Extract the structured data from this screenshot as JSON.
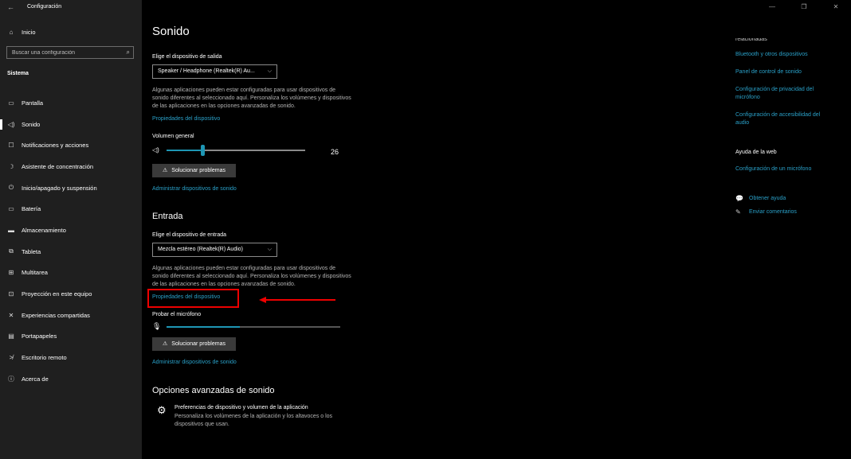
{
  "window": {
    "title": "Configuración",
    "back_icon": "back-arrow-icon"
  },
  "sidebar": {
    "home_label": "Inicio",
    "search": {
      "placeholder": "Buscar una configuración"
    },
    "section": "Sistema",
    "items": [
      {
        "label": "Pantalla",
        "icon": "monitor-icon"
      },
      {
        "label": "Sonido",
        "icon": "speaker-icon",
        "active": true
      },
      {
        "label": "Notificaciones y acciones",
        "icon": "notifications-icon"
      },
      {
        "label": "Asistente de concentración",
        "icon": "moon-icon"
      },
      {
        "label": "Inicio/apagado y suspensión",
        "icon": "power-icon"
      },
      {
        "label": "Batería",
        "icon": "battery-icon"
      },
      {
        "label": "Almacenamiento",
        "icon": "storage-icon"
      },
      {
        "label": "Tableta",
        "icon": "tablet-icon"
      },
      {
        "label": "Multitarea",
        "icon": "multitask-icon"
      },
      {
        "label": "Proyección en este equipo",
        "icon": "projection-icon"
      },
      {
        "label": "Experiencias compartidas",
        "icon": "shared-icon"
      },
      {
        "label": "Portapapeles",
        "icon": "clipboard-icon"
      },
      {
        "label": "Escritorio remoto",
        "icon": "remote-desktop-icon"
      },
      {
        "label": "Acerca de",
        "icon": "info-icon"
      }
    ]
  },
  "main": {
    "title": "Sonido",
    "output": {
      "label": "Elige el dispositivo de salida",
      "device": "Speaker / Headphone (Realtek(R) Au...",
      "description": "Algunas aplicaciones pueden estar configuradas para usar dispositivos de sonido diferentes al seleccionado aquí. Personaliza los volúmenes y dispositivos de las aplicaciones en las opciones avanzadas de sonido.",
      "properties_link": "Propiedades del dispositivo",
      "volume_label": "Volumen general",
      "volume_value": "26",
      "volume_level": 26,
      "troubleshoot": "Solucionar problemas",
      "manage_link": "Administrar dispositivos de sonido"
    },
    "input": {
      "heading": "Entrada",
      "label": "Elige el dispositivo de entrada",
      "device": "Mezcla estéreo (Realtek(R) Audio)",
      "description": "Algunas aplicaciones pueden estar configuradas para usar dispositivos de sonido diferentes al seleccionado aquí. Personaliza los volúmenes y dispositivos de las aplicaciones en las opciones avanzadas de sonido.",
      "properties_link": "Propiedades del dispositivo",
      "mic_test_label": "Probar el micrófono",
      "mic_level": 42,
      "troubleshoot": "Solucionar problemas",
      "manage_link": "Administrar dispositivos de sonido"
    },
    "advanced": {
      "heading": "Opciones avanzadas de sonido",
      "item_title": "Preferencias de dispositivo y volumen de la aplicación",
      "item_desc": "Personaliza los volúmenes de la aplicación y los altavoces o los dispositivos que usan."
    }
  },
  "right_panel": {
    "related_cut": "relacionadas",
    "related_links": [
      "Bluetooth y otros dispositivos",
      "Panel de control de sonido",
      "Configuración de privacidad del micrófono",
      "Configuración de accesibilidad del audio"
    ],
    "web_help_heading": "Ayuda de la web",
    "web_help_link": "Configuración de un micrófono",
    "get_help": "Obtener ayuda",
    "feedback": "Enviar comentarios"
  },
  "colors": {
    "accent": "#1e96b4",
    "link": "#2aa0c8",
    "annotation": "#e00000",
    "sidebar_bg": "#1f1f1f"
  }
}
